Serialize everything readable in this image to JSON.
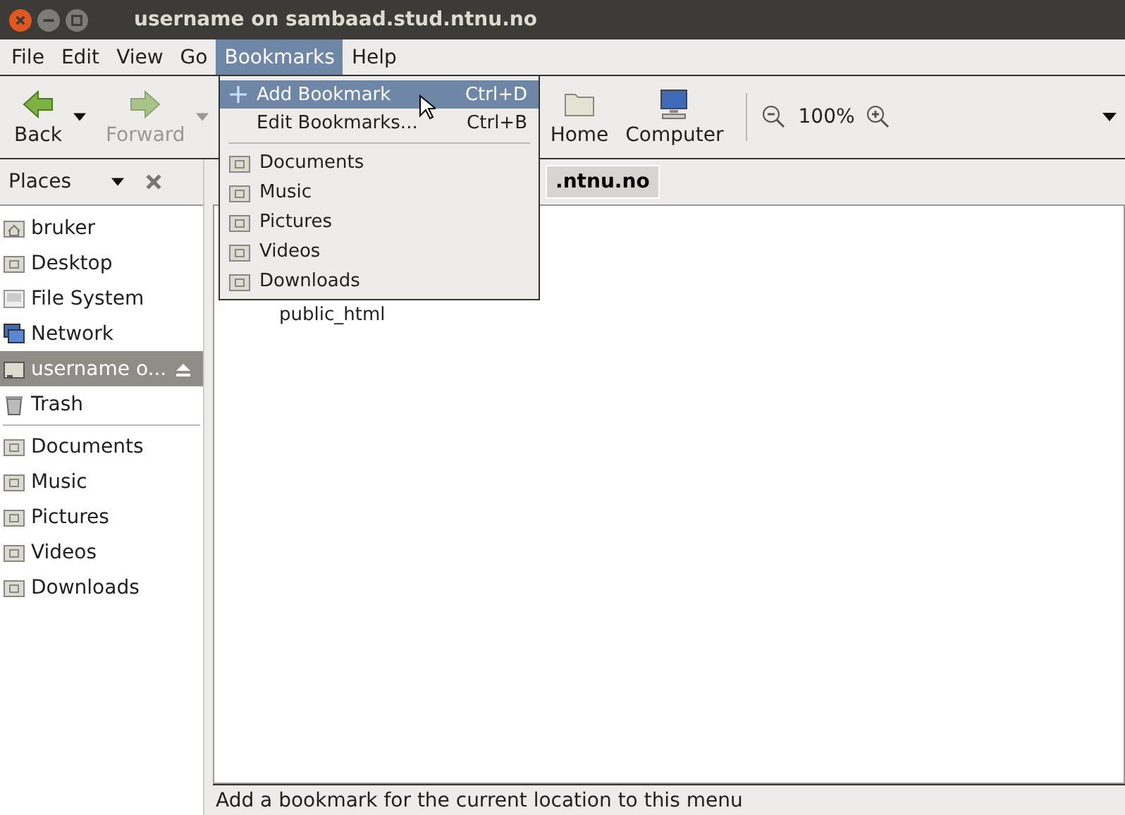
{
  "window": {
    "title": "username on sambaad.stud.ntnu.no"
  },
  "menubar": [
    {
      "label": "File",
      "selected": false
    },
    {
      "label": "Edit",
      "selected": false
    },
    {
      "label": "View",
      "selected": false
    },
    {
      "label": "Go",
      "selected": false
    },
    {
      "label": "Bookmarks",
      "selected": true
    },
    {
      "label": "Help",
      "selected": false
    }
  ],
  "toolbar": {
    "left": [
      {
        "label": "Back",
        "kind": "back",
        "disabled": false
      },
      {
        "label": "Forward",
        "kind": "forward",
        "disabled": true
      }
    ],
    "right": [
      {
        "label": "Home",
        "kind": "home"
      },
      {
        "label": "Computer",
        "kind": "computer"
      }
    ],
    "zoom": "100%"
  },
  "sidebar": {
    "title": "Places",
    "items": [
      {
        "label": "bruker",
        "kind": "home",
        "selected": false
      },
      {
        "label": "Desktop",
        "kind": "folder",
        "selected": false
      },
      {
        "label": "File System",
        "kind": "drive",
        "selected": false
      },
      {
        "label": "Network",
        "kind": "network",
        "selected": false
      },
      {
        "label": "username o...",
        "kind": "mount",
        "selected": true
      },
      {
        "label": "Trash",
        "kind": "trash",
        "selected": false
      }
    ],
    "bookmarks": [
      {
        "label": "Documents"
      },
      {
        "label": "Music"
      },
      {
        "label": "Pictures"
      },
      {
        "label": "Videos"
      },
      {
        "label": "Downloads"
      }
    ]
  },
  "path_bar": {
    "label": ".ntnu.no"
  },
  "files": [
    {
      "label": "public_html"
    }
  ],
  "bookmarks_menu": {
    "actions": [
      {
        "label": "Add Bookmark",
        "shortcut": "Ctrl+D",
        "kind": "add",
        "selected": true
      },
      {
        "label": "Edit Bookmarks...",
        "shortcut": "Ctrl+B",
        "kind": "edit",
        "selected": false
      }
    ],
    "bookmarks": [
      {
        "label": "Documents"
      },
      {
        "label": "Music"
      },
      {
        "label": "Pictures"
      },
      {
        "label": "Videos"
      },
      {
        "label": "Downloads"
      }
    ]
  },
  "status_bar": "Add a bookmark for the current location to this menu"
}
